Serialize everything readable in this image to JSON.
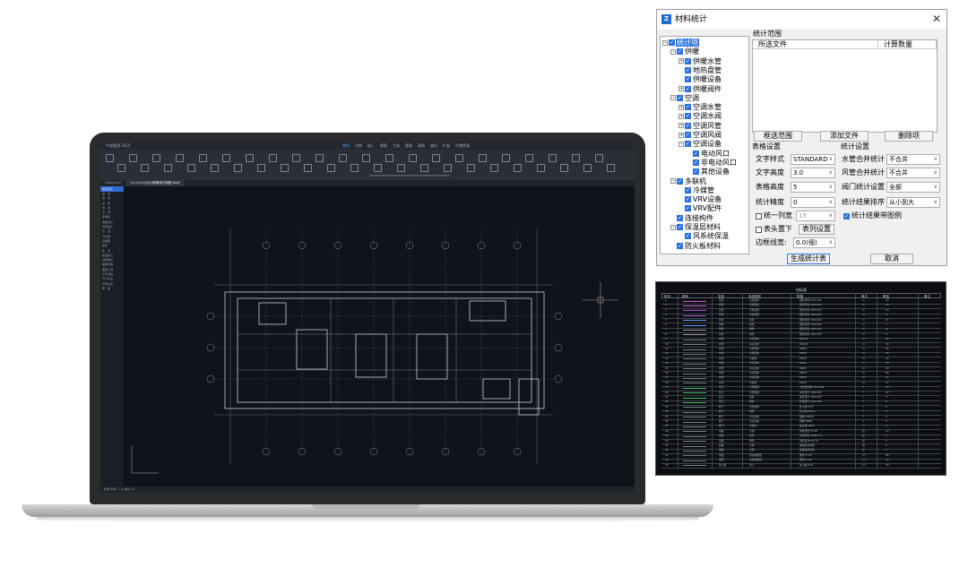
{
  "cad": {
    "title": "中望暖通 2025",
    "menu": [
      "常用",
      "注释",
      "插入",
      "视图",
      "工具",
      "管理",
      "帮助",
      "输出",
      "扩展",
      "中望资源"
    ],
    "menu_active_index": 0,
    "tabs": [
      "Drawing1*",
      "××××××办公楼暖通平面图.dwg*"
    ],
    "active_tab_index": 1,
    "sidebar_head": "暖通天正",
    "sidebar": [
      "设　置",
      "暖　通",
      "采　暖",
      "通　风",
      "空　调",
      "多联机",
      "地暖设计",
      "风管设计",
      "管　道",
      "冷热源",
      "设备图",
      "附件",
      "外　管",
      "保温设计",
      "材料统计",
      "图库管理",
      "图纸工具",
      "文字表格",
      "尺寸标注",
      "符号标注",
      "帮　助"
    ],
    "status": "模型  布局1  ×  ⊕  坐标 0,0"
  },
  "dialog": {
    "title": "材料统计",
    "tree": [
      {
        "label": "统计项",
        "level": 0,
        "exp": "-",
        "selected": true
      },
      {
        "label": "供暖",
        "level": 1,
        "exp": "-"
      },
      {
        "label": "供暖水管",
        "level": 2,
        "exp": "+"
      },
      {
        "label": "地热盘管",
        "level": 2,
        "exp": ""
      },
      {
        "label": "供暖设备",
        "level": 2,
        "exp": ""
      },
      {
        "label": "供暖阀件",
        "level": 2,
        "exp": "+"
      },
      {
        "label": "空调",
        "level": 1,
        "exp": "-"
      },
      {
        "label": "空调水管",
        "level": 2,
        "exp": "+"
      },
      {
        "label": "空调水阀",
        "level": 2,
        "exp": "+"
      },
      {
        "label": "空调风管",
        "level": 2,
        "exp": "+"
      },
      {
        "label": "空调风阀",
        "level": 2,
        "exp": "+"
      },
      {
        "label": "空调设备",
        "level": 2,
        "exp": "-"
      },
      {
        "label": "电动风口",
        "level": 3,
        "exp": ""
      },
      {
        "label": "非电动风口",
        "level": 3,
        "exp": ""
      },
      {
        "label": "其他设备",
        "level": 3,
        "exp": ""
      },
      {
        "label": "多联机",
        "level": 1,
        "exp": "-"
      },
      {
        "label": "冷媒管",
        "level": 2,
        "exp": ""
      },
      {
        "label": "VRV设备",
        "level": 2,
        "exp": ""
      },
      {
        "label": "VRV配件",
        "level": 2,
        "exp": ""
      },
      {
        "label": "连接构件",
        "level": 1,
        "exp": ""
      },
      {
        "label": "保温层材料",
        "level": 1,
        "exp": "-"
      },
      {
        "label": "风系统保温",
        "level": 2,
        "exp": ""
      },
      {
        "label": "防火板材料",
        "level": 1,
        "exp": ""
      }
    ],
    "range_label": "统计范围",
    "file_columns": [
      "所选文件",
      "计算数量"
    ],
    "btn_select_range": "框选范围",
    "btn_add_file": "添加文件",
    "btn_delete": "删除项",
    "table_settings_label": "表格设置",
    "stat_settings_label": "统计设置",
    "text_style_label": "文字样式",
    "text_style_value": "STANDARD",
    "text_height_label": "文字高度",
    "text_height_value": "3.0",
    "table_height_label": "表格高度",
    "table_height_value": "5",
    "precision_label": "统计精度",
    "precision_value": "0",
    "unify_width_label": "统一列宽",
    "unify_width_value": "15",
    "header_below_label": "表头置下",
    "column_settings_button": "表列设置",
    "border_width_label": "边框线宽:",
    "border_width_value": "0.0(细)",
    "water_merge_label": "水管合并统计",
    "water_merge_value": "不合并",
    "air_merge_label": "风管合并统计",
    "air_merge_value": "不合并",
    "valve_stat_label": "阀门统计设置",
    "valve_stat_value": "全部",
    "sort_label": "统计结果排序",
    "sort_value": "从小到大",
    "with_legend_label": "统计结果带图例",
    "generate_button": "生成统计表",
    "cancel_button": "取消"
  },
  "table": {
    "title": "材料表",
    "headers": [
      "序号",
      "图例",
      "名称",
      "系统类型",
      "规格",
      "单位",
      "数量",
      "备注"
    ],
    "rows": [
      [
        "1",
        "",
        "风管",
        "空调送风",
        "矩形风管 800x400",
        "m",
        "23"
      ],
      [
        "2",
        "",
        "风管",
        "空调送风",
        "矩形风管 630x320",
        "m",
        "18"
      ],
      [
        "3",
        "",
        "风管",
        "空调回风",
        "矩形风管 500x250",
        "m",
        "12"
      ],
      [
        "4",
        "",
        "风管",
        "空调回风",
        "矩形风管 400x200",
        "m",
        "9"
      ],
      [
        "5",
        "",
        "风管",
        "新风",
        "矩形风管 320x200",
        "m",
        "15"
      ],
      [
        "6",
        "",
        "风管",
        "新风",
        "矩形风管 250x160",
        "m",
        "7"
      ],
      [
        "7",
        "",
        "风管",
        "排风",
        "矩形风管 200x120",
        "m",
        "11"
      ],
      [
        "8",
        "",
        "风管",
        "排风",
        "矩形风管 160x120",
        "m",
        "5"
      ],
      [
        "9",
        "",
        "水管",
        "冷冻供水",
        "DN100",
        "m",
        "32"
      ],
      [
        "10",
        "",
        "水管",
        "冷冻回水",
        "DN100",
        "m",
        "32"
      ],
      [
        "11",
        "",
        "水管",
        "冷却供水",
        "DN80",
        "m",
        "26"
      ],
      [
        "12",
        "",
        "水管",
        "冷却回水",
        "DN80",
        "m",
        "26"
      ],
      [
        "13",
        "",
        "水管",
        "冷凝水",
        "DN32",
        "m",
        "41"
      ],
      [
        "14",
        "",
        "水管",
        "冷冻供水",
        "DN65",
        "m",
        "19"
      ],
      [
        "15",
        "",
        "水管",
        "冷冻回水",
        "DN65",
        "m",
        "19"
      ],
      [
        "16",
        "",
        "水管",
        "冷冻供水",
        "DN50",
        "m",
        "24"
      ],
      [
        "17",
        "",
        "水管",
        "冷冻回水",
        "DN50",
        "m",
        "24"
      ],
      [
        "18",
        "",
        "水管",
        "冷凝水",
        "DN25",
        "m",
        "17"
      ],
      [
        "19",
        "",
        "风口",
        "空调送风",
        "方形散流器 300x300",
        "个",
        "16"
      ],
      [
        "20",
        "",
        "风口",
        "空调回风",
        "单层百叶 400x200",
        "个",
        "12"
      ],
      [
        "21",
        "",
        "风口",
        "新风",
        "双层百叶 300x150",
        "个",
        "8"
      ],
      [
        "22",
        "",
        "风口",
        "排风",
        "防雨百叶 500x300",
        "个",
        "4"
      ],
      [
        "23",
        "",
        "阀门",
        "空调送风",
        "防火阀 70℃",
        "个",
        "6"
      ],
      [
        "24",
        "",
        "阀门",
        "排风",
        "防火阀 280℃",
        "个",
        "3"
      ],
      [
        "25",
        "",
        "阀门",
        "冷冻供水",
        "蝶阀 DN100",
        "个",
        "4"
      ],
      [
        "26",
        "",
        "阀门",
        "冷冻回水",
        "闸阀 DN65",
        "个",
        "6"
      ],
      [
        "27",
        "",
        "阀门",
        "冷凝水",
        "截止阀 DN25",
        "个",
        "8"
      ],
      [
        "28",
        "",
        "设备",
        "空调",
        "风机盘管 FP-68",
        "台",
        "14"
      ],
      [
        "29",
        "",
        "设备",
        "新风",
        "新风机组 3000m³/h",
        "台",
        "2"
      ],
      [
        "30",
        "",
        "设备",
        "排风",
        "排风扇 800m³/h",
        "台",
        "5"
      ],
      [
        "31",
        "",
        "设备",
        "空调",
        "多联机室内机",
        "台",
        "9"
      ],
      [
        "32",
        "",
        "设备",
        "空调",
        "多联机室外机",
        "台",
        "1"
      ],
      [
        "33",
        "",
        "保温",
        "风系统保温",
        "橡塑 δ=25",
        "m²",
        "86"
      ],
      [
        "34",
        "",
        "保温",
        "水系统保温",
        "橡塑 δ=20",
        "m²",
        "52"
      ],
      [
        "35",
        "",
        "防火板",
        "防火",
        "防火板 δ=9",
        "m²",
        "18"
      ]
    ]
  },
  "colors": {
    "accent": "#2d72d9",
    "cad_bg": "#10131a",
    "dialog_bg": "#f0f0f0"
  }
}
